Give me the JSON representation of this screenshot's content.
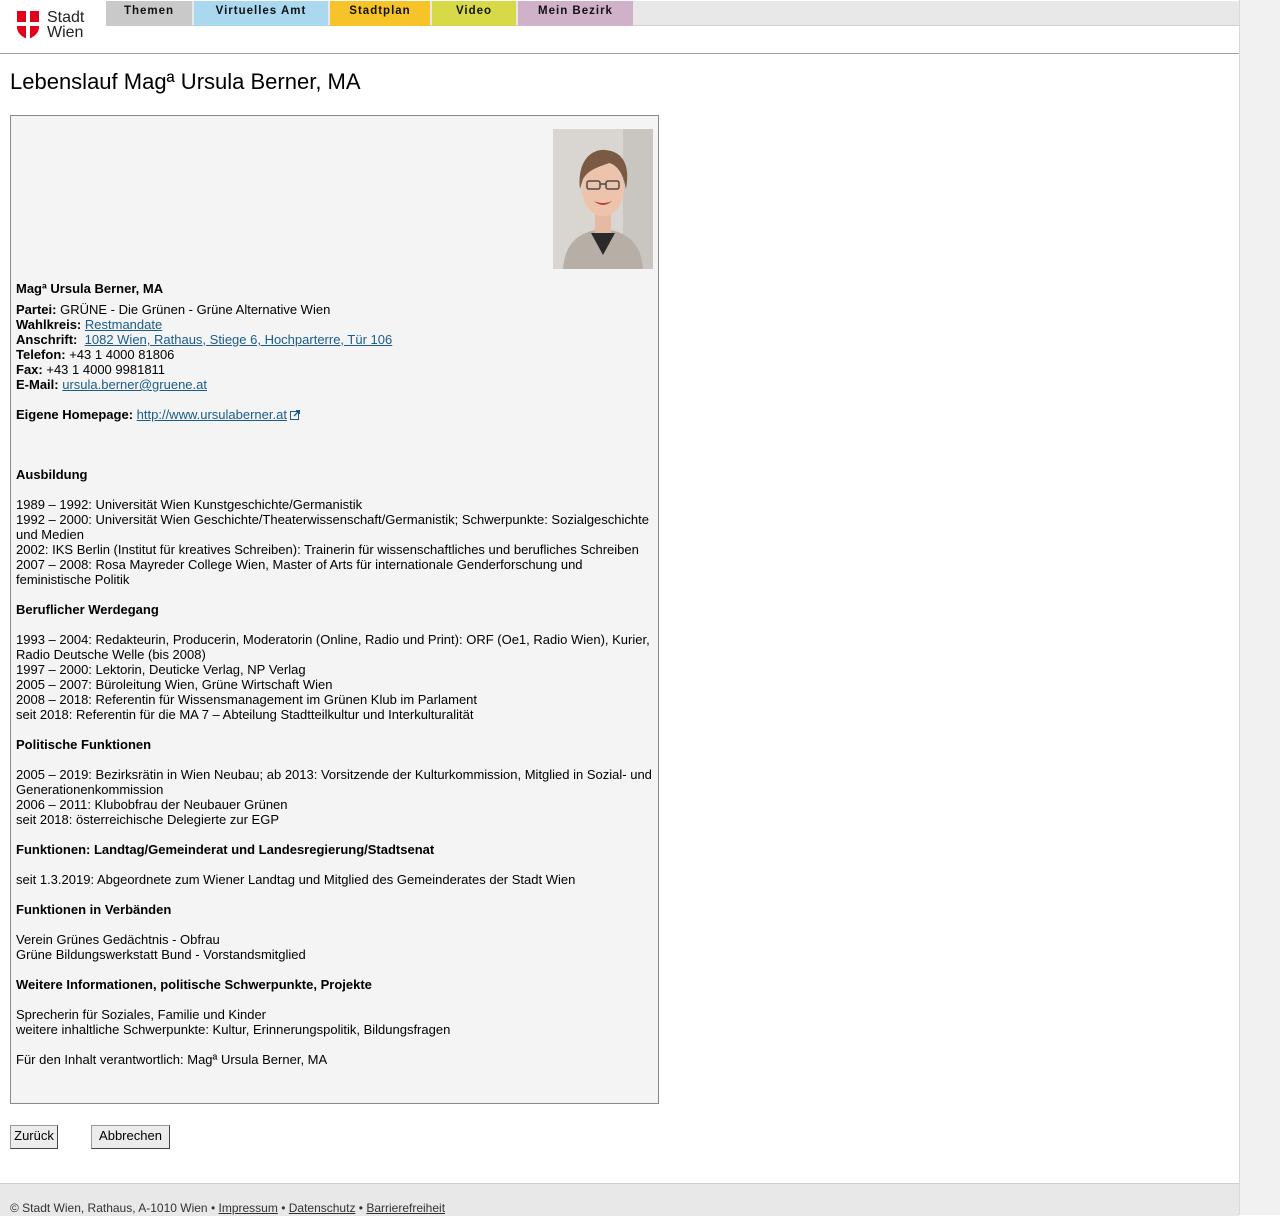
{
  "logo": {
    "line1": "Stadt",
    "line2": "Wien"
  },
  "nav": {
    "tabs": [
      {
        "label": "Themen",
        "color": "#c9c9c9"
      },
      {
        "label": "Virtuelles Amt",
        "color": "#a9d8ef"
      },
      {
        "label": "Stadtplan",
        "color": "#f6c329"
      },
      {
        "label": "Video",
        "color": "#d8d949"
      },
      {
        "label": "Mein Bezirk",
        "color": "#cfb1ca"
      }
    ]
  },
  "page_title": "Lebenslauf Magª Ursula Berner, MA",
  "profile": {
    "name": "Magª Ursula Berner, MA",
    "partei_label": "Partei:",
    "partei": "GRÜNE - Die Grünen - Grüne Alternative Wien",
    "wahlkreis_label": "Wahlkreis:",
    "wahlkreis": "Restmandate",
    "anschrift_label": "Anschrift:",
    "anschrift": "1082 Wien, Rathaus, Stiege 6, Hochparterre, Tür 106",
    "telefon_label": "Telefon:",
    "telefon": "+43 1 4000 81806",
    "fax_label": "Fax:",
    "fax": "+43 1 4000 9981811",
    "email_label": "E-Mail:",
    "email": "ursula.berner@gruene.at",
    "homepage_label": "Eigene Homepage:",
    "homepage": "http://www.ursulaberner.at"
  },
  "sections": {
    "ausbildung": {
      "title": "Ausbildung",
      "lines": [
        "1989 – 1992: Universität Wien Kunstgeschichte/Germanistik",
        "1992 – 2000: Universität Wien Geschichte/Theaterwissenschaft/Germanistik; Schwerpunkte: Sozialgeschichte und Medien",
        "2002: IKS Berlin (Institut für kreatives Schreiben): Trainerin für wissenschaftliches und berufliches Schreiben",
        "2007 – 2008: Rosa Mayreder College Wien, Master of Arts für internationale Genderforschung und feministische Politik"
      ]
    },
    "beruf": {
      "title": "Beruflicher Werdegang",
      "lines": [
        "1993 – 2004: Redakteurin, Producerin, Moderatorin (Online, Radio und Print): ORF (Oe1, Radio Wien), Kurier, Radio Deutsche Welle (bis 2008)",
        "1997 – 2000: Lektorin, Deuticke Verlag, NP Verlag",
        "2005 – 2007: Büroleitung Wien, Grüne Wirtschaft Wien",
        "2008 – 2018: Referentin für Wissensmanagement im Grünen Klub im Parlament",
        "seit 2018: Referentin für die MA 7 – Abteilung Stadtteilkultur und Interkulturalität"
      ]
    },
    "politik": {
      "title": "Politische Funktionen",
      "lines": [
        "2005 – 2019: Bezirksrätin in Wien Neubau; ab 2013: Vorsitzende der Kulturkommission, Mitglied in Sozial- und Generationenkommission",
        "2006 – 2011: Klubobfrau der Neubauer Grünen",
        "seit 2018: österreichische Delegierte zur EGP"
      ]
    },
    "landtag": {
      "title": "Funktionen: Landtag/Gemeinderat und Landesregierung/Stadtsenat",
      "lines": [
        "seit 1.3.2019: Abgeordnete zum Wiener Landtag und Mitglied des Gemeinderates der Stadt Wien"
      ]
    },
    "verbaende": {
      "title": "Funktionen in Verbänden",
      "lines": [
        "Verein Grünes Gedächtnis - Obfrau",
        "Grüne Bildungswerkstatt Bund - Vorstandsmitglied"
      ]
    },
    "weitere": {
      "title": "Weitere Informationen, politische Schwerpunkte, Projekte",
      "lines": [
        "Sprecherin für Soziales, Familie und Kinder",
        "weitere inhaltliche Schwerpunkte: Kultur, Erinnerungspolitik, Bildungsfragen"
      ]
    }
  },
  "responsible": "Für den Inhalt verantwortlich: Magª Ursula Berner, MA",
  "buttons": {
    "back": "Zurück",
    "cancel": "Abbrechen"
  },
  "footer": {
    "copyright": "© Stadt Wien, Rathaus, A-1010 Wien",
    "sep": "•",
    "impressum": "Impressum",
    "datenschutz": "Datenschutz",
    "barrierefreiheit": "Barrierefreiheit"
  },
  "icons": {
    "logo": "vienna-shield-icon",
    "external_link": "external-link-icon"
  }
}
